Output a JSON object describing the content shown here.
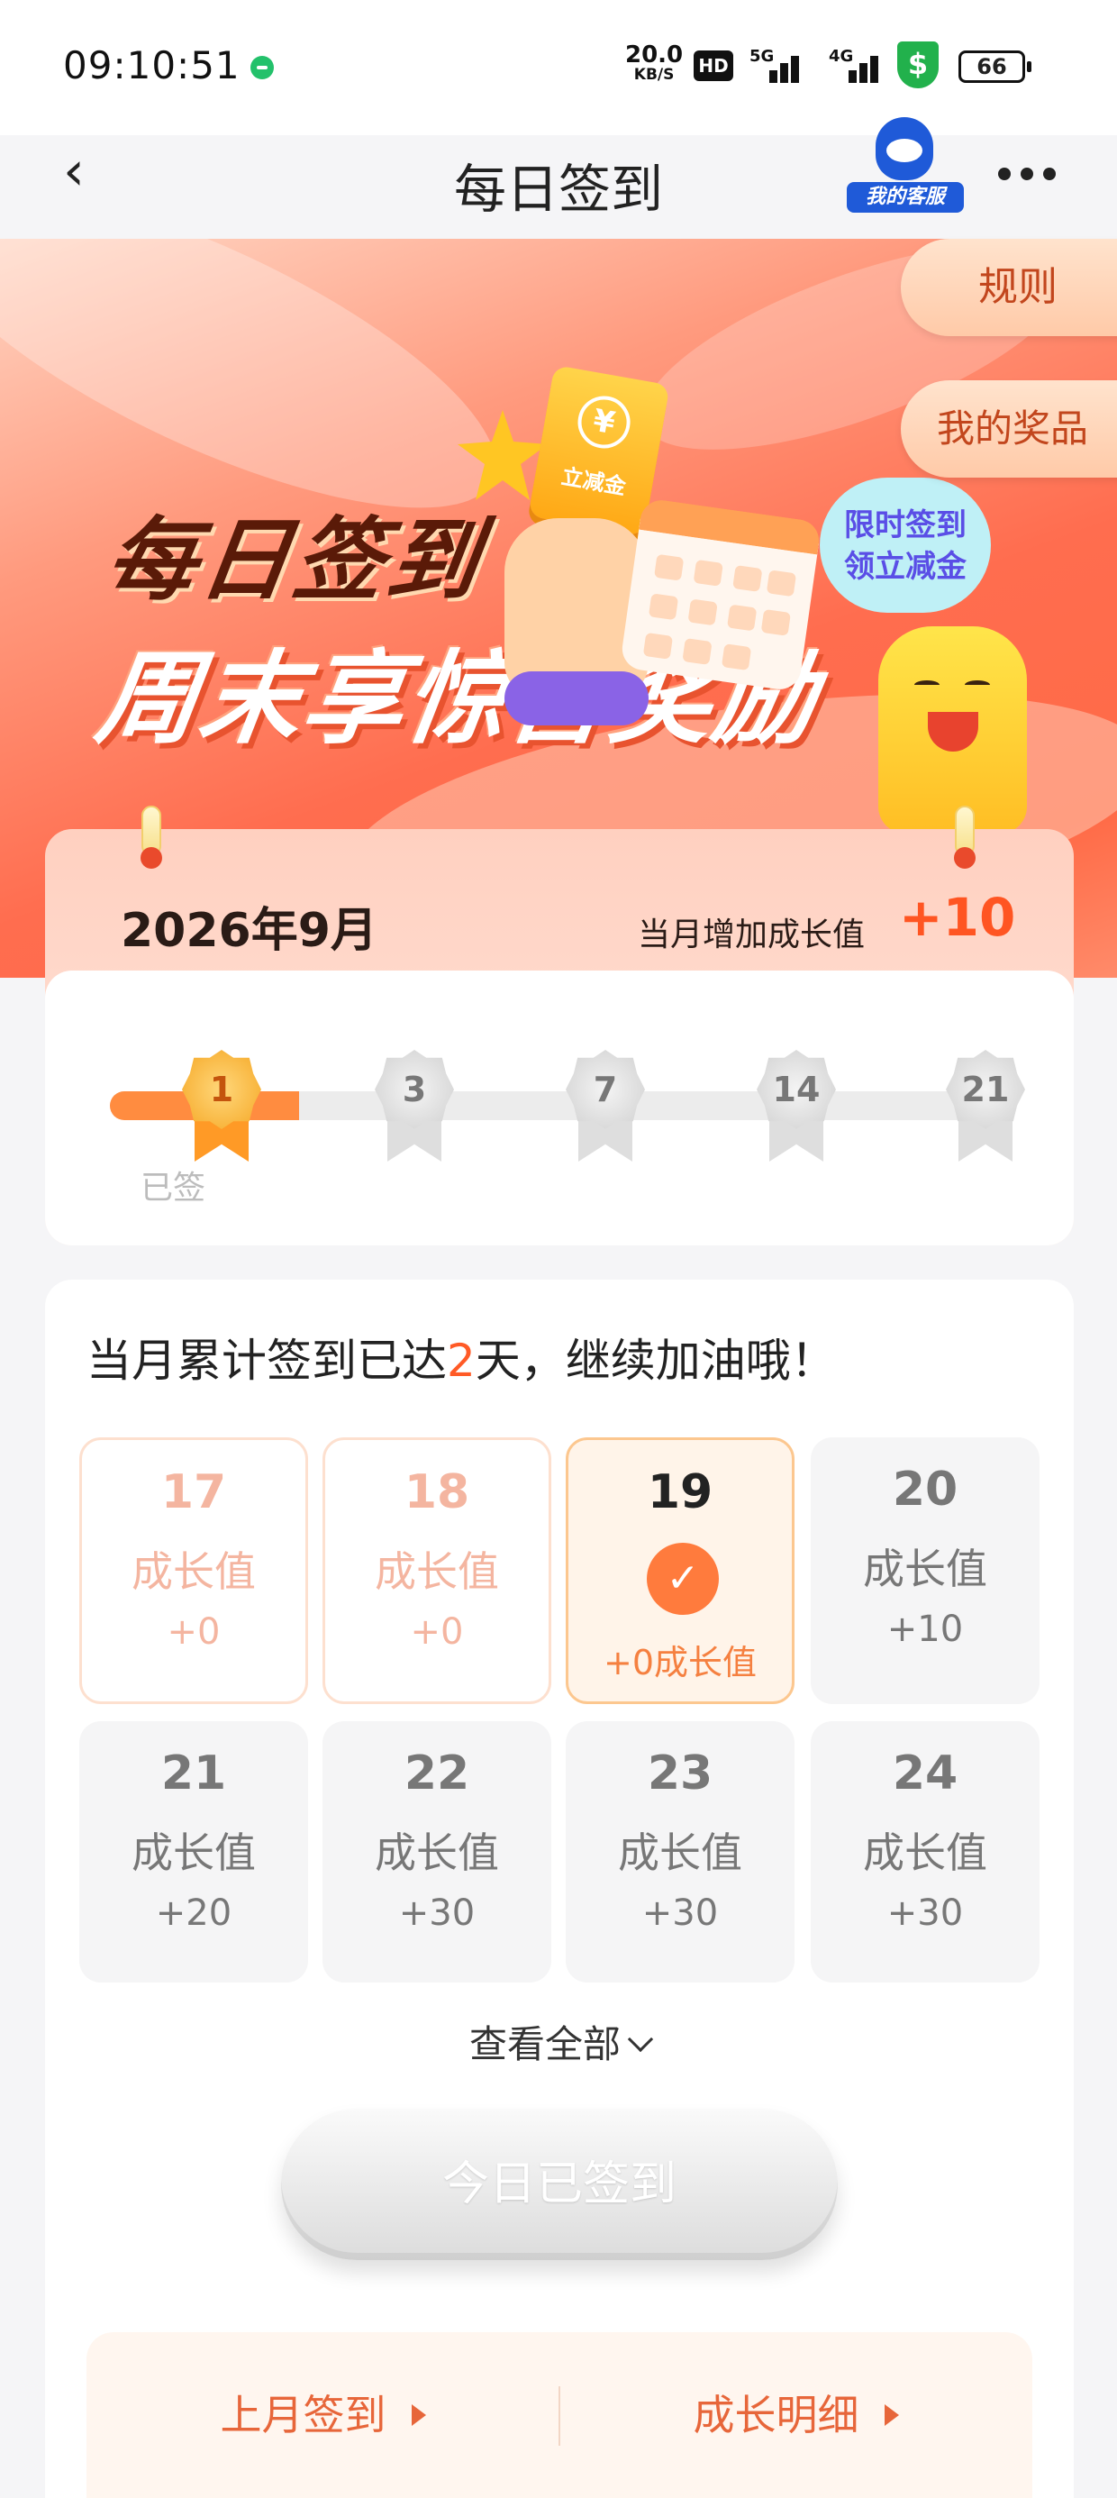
{
  "status_bar": {
    "time": "09:10:51",
    "net_speed": "20.0",
    "net_unit": "KB/S",
    "hd": "HD",
    "sig1": "5G",
    "sig2": "4G",
    "battery": "66"
  },
  "nav": {
    "title": "每日签到",
    "service_label": "我的客服"
  },
  "hero": {
    "rule_tab": "规则",
    "prize_tab": "我的奖品",
    "title_line1": "每日签到",
    "title_line2": "周末享惊喜奖励",
    "coupon_label": "立减金",
    "coupon_symbol": "¥",
    "bubble_line1": "限时签到",
    "bubble_line2": "领立减金"
  },
  "month": {
    "label": "2026年9月",
    "growth_label": "当月增加成长值",
    "growth_value": "+10",
    "milestones": [
      "1",
      "3",
      "7",
      "14",
      "21"
    ],
    "signed_label": "已签",
    "progress_fraction": 0.21
  },
  "calendar": {
    "head_prefix": "当月累计签到已达",
    "head_days": "2",
    "head_suffix": "天，继续加油哦！",
    "days": [
      {
        "date": "17",
        "label": "成长值",
        "value": "+0",
        "state": "past"
      },
      {
        "date": "18",
        "label": "成长值",
        "value": "+0",
        "state": "past"
      },
      {
        "date": "19",
        "label": "",
        "value": "+0成长值",
        "state": "today"
      },
      {
        "date": "20",
        "label": "成长值",
        "value": "+10",
        "state": "future"
      },
      {
        "date": "21",
        "label": "成长值",
        "value": "+20",
        "state": "future"
      },
      {
        "date": "22",
        "label": "成长值",
        "value": "+30",
        "state": "future"
      },
      {
        "date": "23",
        "label": "成长值",
        "value": "+30",
        "state": "future"
      },
      {
        "date": "24",
        "label": "成长值",
        "value": "+30",
        "state": "future"
      }
    ],
    "view_all": "查看全部",
    "sign_button": "今日已签到",
    "last_month_link": "上月签到",
    "growth_detail_link": "成长明细"
  },
  "colors": {
    "accent": "#ff5a26",
    "link": "#e7663a",
    "progress": "#ff8c40"
  }
}
